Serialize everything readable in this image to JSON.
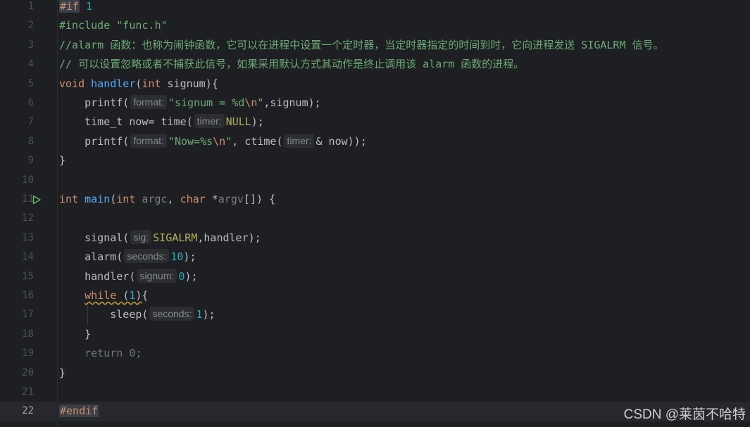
{
  "editor": {
    "lines": [
      {
        "n": "1"
      },
      {
        "n": "2"
      },
      {
        "n": "3"
      },
      {
        "n": "4"
      },
      {
        "n": "5"
      },
      {
        "n": "6"
      },
      {
        "n": "7"
      },
      {
        "n": "8"
      },
      {
        "n": "9"
      },
      {
        "n": "10"
      },
      {
        "n": "11"
      },
      {
        "n": "12"
      },
      {
        "n": "13"
      },
      {
        "n": "14"
      },
      {
        "n": "15"
      },
      {
        "n": "16"
      },
      {
        "n": "17"
      },
      {
        "n": "18"
      },
      {
        "n": "19"
      },
      {
        "n": "20"
      },
      {
        "n": "21"
      },
      {
        "n": "22"
      }
    ],
    "current_line": "22",
    "run_icon_line": "11",
    "colors": {
      "background": "#1e1f22",
      "keyword": "#cf8e6d",
      "string": "#6aab73",
      "number": "#2aacb8",
      "function": "#56a8f5",
      "macro": "#b3ae60"
    },
    "icons": {
      "run": "run-gutter-icon"
    },
    "code": {
      "l1_directive": "#if",
      "l1_value": "1",
      "l2_text": "#include \"func.h\"",
      "l3_comment": "//alarm 函数：也称为闹钟函数，它可以在进程中设置一个定时器，当定时器指定的时间到时，它向进程发送 SIGALRM 信号。",
      "l4_comment": "// 可以设置忽略或者不捕获此信号，如果采用默认方式其动作是终止调用该 alarm 函数的进程。",
      "l5_void": "void",
      "l5_name": "handler",
      "l5_open": "(",
      "l5_int": "int",
      "l5_rest": " signum){",
      "l6_call": "printf(",
      "l6_hint": "format:",
      "l6_str1": "\"signum = %d",
      "l6_esc": "\\n",
      "l6_str2": "\"",
      "l6_rest": ",signum);",
      "l7_a": "time_t now= time(",
      "l7_hint": "timer:",
      "l7_null": "NULL",
      "l7_rest": ");",
      "l8_call": "printf(",
      "l8_hint": "format:",
      "l8_str1": "\"Now=%s",
      "l8_esc": "\\n",
      "l8_str2": "\"",
      "l8_mid": ", ctime(",
      "l8_hint2": "timer:",
      "l8_rest": "& now));",
      "l9_text": "}",
      "l11_int": "int",
      "l11_name": "main",
      "l11_open": "(",
      "l11_int2": "int",
      "l11_argc": " argc",
      "l11_comma": ", ",
      "l11_char": "char",
      "l11_star": " *",
      "l11_argv": "argv",
      "l11_rest": "[]) {",
      "l13_call": "signal(",
      "l13_hint": "sig:",
      "l13_macro": "SIGALRM",
      "l13_rest": ",handler);",
      "l14_call": "alarm(",
      "l14_hint": "seconds:",
      "l14_num": "10",
      "l14_rest": ");",
      "l15_call": "handler(",
      "l15_hint": "signum:",
      "l15_num": "0",
      "l15_rest": ");",
      "l16_while": "while",
      "l16_space": " ",
      "l16_open": "(",
      "l16_num": "1",
      "l16_close": ")",
      "l16_rest": "{",
      "l17_call": "sleep(",
      "l17_hint": "seconds:",
      "l17_num": "1",
      "l17_rest": ");",
      "l18_text": "}",
      "l19_text": "return 0;",
      "l20_text": "}",
      "l22_text": "#endif"
    }
  },
  "watermark": "CSDN @莱茵不哈特"
}
